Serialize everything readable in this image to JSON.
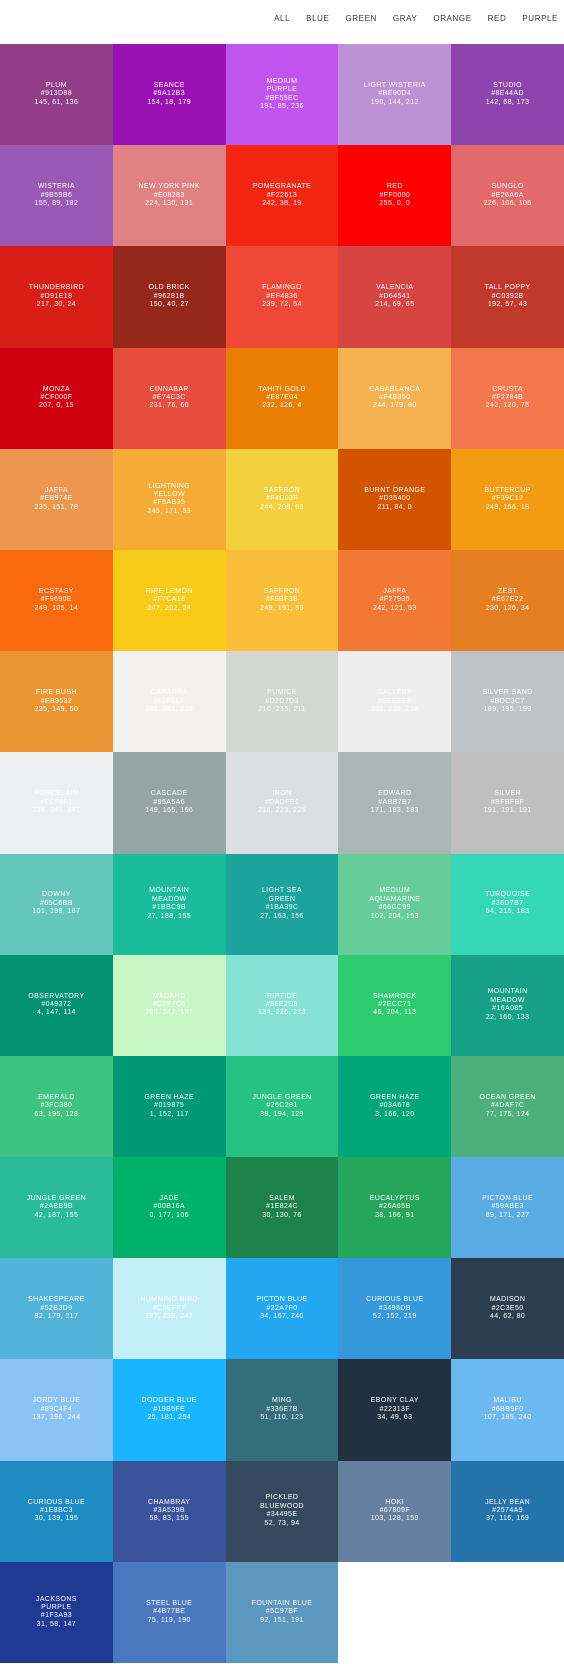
{
  "nav": [
    "ALL",
    "BLUE",
    "GREEN",
    "GRAY",
    "ORANGE",
    "RED",
    "PURPLE"
  ],
  "swatches": [
    {
      "name": "PLUM",
      "hex": "#913D88",
      "rgb": "145, 61, 136"
    },
    {
      "name": "SEANCE",
      "hex": "#9A12B3",
      "rgb": "154, 18, 179"
    },
    {
      "name": "MEDIUM PURPLE",
      "hex": "#BF55EC",
      "rgb": "191, 85, 236"
    },
    {
      "name": "LIGHT WISTERIA",
      "hex": "#BE90D4",
      "rgb": "190, 144, 212"
    },
    {
      "name": "STUDIO",
      "hex": "#8E44AD",
      "rgb": "142, 68, 173"
    },
    {
      "name": "WISTERIA",
      "hex": "#9B59B6",
      "rgb": "155, 89, 182"
    },
    {
      "name": "NEW YORK PINK",
      "hex": "#E08283",
      "rgb": "224, 130, 131"
    },
    {
      "name": "POMEGRANATE",
      "hex": "#F22613",
      "rgb": "242, 38, 19"
    },
    {
      "name": "RED",
      "hex": "#FF0000",
      "rgb": "255, 0, 0"
    },
    {
      "name": "SUNGLO",
      "hex": "#E26A6A",
      "rgb": "226, 106, 106"
    },
    {
      "name": "THUNDERBIRD",
      "hex": "#D91E18",
      "rgb": "217, 30, 24"
    },
    {
      "name": "OLD BRICK",
      "hex": "#96281B",
      "rgb": "150, 40, 27"
    },
    {
      "name": "FLAMINGO",
      "hex": "#EF4836",
      "rgb": "239, 72, 54"
    },
    {
      "name": "VALENCIA",
      "hex": "#D64541",
      "rgb": "214, 69, 65"
    },
    {
      "name": "TALL POPPY",
      "hex": "#C0392B",
      "rgb": "192, 57, 43"
    },
    {
      "name": "MONZA",
      "hex": "#CF000F",
      "rgb": "207, 0, 15"
    },
    {
      "name": "CINNABAR",
      "hex": "#E74C3C",
      "rgb": "231, 76, 60"
    },
    {
      "name": "TAHITI GOLD",
      "hex": "#E87E04",
      "rgb": "232, 126, 4"
    },
    {
      "name": "CASABLANCA",
      "hex": "#F4B350",
      "rgb": "244, 179, 80"
    },
    {
      "name": "CRUSTA",
      "hex": "#F2784B",
      "rgb": "242, 120, 75"
    },
    {
      "name": "JAFFA",
      "hex": "#EB974E",
      "rgb": "235, 151, 78"
    },
    {
      "name": "LIGHTNING YELLOW",
      "hex": "#F5AB35",
      "rgb": "245, 171, 53"
    },
    {
      "name": "SAFFRON",
      "hex": "#F4D03F",
      "rgb": "244, 208, 63"
    },
    {
      "name": "BURNT ORANGE",
      "hex": "#D35400",
      "rgb": "211, 84, 0"
    },
    {
      "name": "BUTTERCUP",
      "hex": "#F39C12",
      "rgb": "243, 156, 18"
    },
    {
      "name": "ECSTASY",
      "hex": "#F9690E",
      "rgb": "249, 105, 14"
    },
    {
      "name": "RIPE LEMON",
      "hex": "#F7CA18",
      "rgb": "247, 202, 24"
    },
    {
      "name": "SAFFRON",
      "hex": "#F9BF3B",
      "rgb": "249, 191, 59"
    },
    {
      "name": "JAFFA",
      "hex": "#F27935",
      "rgb": "242, 121, 53"
    },
    {
      "name": "ZEST",
      "hex": "#E67E22",
      "rgb": "230, 126, 34"
    },
    {
      "name": "FIRE BUSH",
      "hex": "#EB9532",
      "rgb": "235, 149, 50"
    },
    {
      "name": "CARARRA",
      "hex": "#F2F1EF",
      "rgb": "242, 241, 239"
    },
    {
      "name": "PUMICE",
      "hex": "#D2D7D3",
      "rgb": "210, 215, 211"
    },
    {
      "name": "GALLERY",
      "hex": "#EEEEEE",
      "rgb": "238, 238, 238"
    },
    {
      "name": "SILVER SAND",
      "hex": "#BDC3C7",
      "rgb": "189, 195, 199"
    },
    {
      "name": "PORCELAIN",
      "hex": "#ECF0F1",
      "rgb": "236, 240, 241"
    },
    {
      "name": "CASCADE",
      "hex": "#95A5A6",
      "rgb": "149, 165, 166"
    },
    {
      "name": "IRON",
      "hex": "#DADFE1",
      "rgb": "218, 223, 225"
    },
    {
      "name": "EDWARD",
      "hex": "#ABB7B7",
      "rgb": "171, 183, 183"
    },
    {
      "name": "SILVER",
      "hex": "#BFBFBF",
      "rgb": "191, 191, 191"
    },
    {
      "name": "DOWNY",
      "hex": "#65C6BB",
      "rgb": "101, 198, 187"
    },
    {
      "name": "MOUNTAIN MEADOW",
      "hex": "#1BBC9B",
      "rgb": "27, 188, 155"
    },
    {
      "name": "LIGHT SEA GREEN",
      "hex": "#1BA39C",
      "rgb": "27, 163, 156"
    },
    {
      "name": "MEDIUM AQUAMARINE",
      "hex": "#66CC99",
      "rgb": "102, 204, 153"
    },
    {
      "name": "TURQUOISE",
      "hex": "#36D7B7",
      "rgb": "54, 215, 183"
    },
    {
      "name": "OBSERVATORY",
      "hex": "#049372",
      "rgb": "4, 147, 114"
    },
    {
      "name": "MADANG",
      "hex": "#C8F7C5",
      "rgb": "200, 247, 197"
    },
    {
      "name": "RIPTIDE",
      "hex": "#86E2D5",
      "rgb": "134, 226, 213"
    },
    {
      "name": "SHAMROCK",
      "hex": "#2ECC71",
      "rgb": "46, 204, 113"
    },
    {
      "name": "MOUNTAIN MEADOW",
      "hex": "#16A085",
      "rgb": "22, 160, 133"
    },
    {
      "name": "EMERALD",
      "hex": "#3FC380",
      "rgb": "63, 195, 128"
    },
    {
      "name": "GREEN HAZE",
      "hex": "#019875",
      "rgb": "1, 152, 117"
    },
    {
      "name": "JUNGLE GREEN",
      "hex": "#26C281",
      "rgb": "38, 194, 129"
    },
    {
      "name": "GREEN HAZE",
      "hex": "#03A678",
      "rgb": "3, 166, 120"
    },
    {
      "name": "OCEAN GREEN",
      "hex": "#4DAF7C",
      "rgb": "77, 175, 124"
    },
    {
      "name": "JUNGLE GREEN",
      "hex": "#2ABB9B",
      "rgb": "42, 187, 155"
    },
    {
      "name": "JADE",
      "hex": "#00B16A",
      "rgb": "0, 177, 106"
    },
    {
      "name": "SALEM",
      "hex": "#1E824C",
      "rgb": "30, 130, 76"
    },
    {
      "name": "EUCALYPTUS",
      "hex": "#26A65B",
      "rgb": "38, 166, 91"
    },
    {
      "name": "PICTON BLUE",
      "hex": "#59ABE3",
      "rgb": "89, 171, 227"
    },
    {
      "name": "SHAKESPEARE",
      "hex": "#52B3D9",
      "rgb": "82, 179, 217"
    },
    {
      "name": "HUMMING BIRD",
      "hex": "#C5EFF7",
      "rgb": "197, 239, 247"
    },
    {
      "name": "PICTON BLUE",
      "hex": "#22A7F0",
      "rgb": "34, 167, 240"
    },
    {
      "name": "CURIOUS BLUE",
      "hex": "#3498DB",
      "rgb": "52, 152, 219"
    },
    {
      "name": "MADISON",
      "hex": "#2C3E50",
      "rgb": "44, 62, 80"
    },
    {
      "name": "JORDY BLUE",
      "hex": "#89C4F4",
      "rgb": "137, 196, 244"
    },
    {
      "name": "DODGER BLUE",
      "hex": "#19B5FE",
      "rgb": "25, 181, 254"
    },
    {
      "name": "MING",
      "hex": "#336E7B",
      "rgb": "51, 110, 123"
    },
    {
      "name": "EBONY CLAY",
      "hex": "#22313F",
      "rgb": "34, 49, 63"
    },
    {
      "name": "MALIBU",
      "hex": "#6BB9F0",
      "rgb": "107, 185, 240"
    },
    {
      "name": "CURIOUS BLUE",
      "hex": "#1E8BC3",
      "rgb": "30, 139, 195"
    },
    {
      "name": "CHAMBRAY",
      "hex": "#3A539B",
      "rgb": "58, 83, 155"
    },
    {
      "name": "PICKLED BLUEWOOD",
      "hex": "#34495E",
      "rgb": "52, 73, 94"
    },
    {
      "name": "HOKI",
      "hex": "#67809F",
      "rgb": "103, 128, 159"
    },
    {
      "name": "JELLY BEAN",
      "hex": "#2574A9",
      "rgb": "37, 116, 169"
    },
    {
      "name": "JACKSONS PURPLE",
      "hex": "#1F3A93",
      "rgb": "31, 58, 147"
    },
    {
      "name": "STEEL BLUE",
      "hex": "#4B77BE",
      "rgb": "75, 119, 190"
    },
    {
      "name": "FOUNTAIN BLUE",
      "hex": "#5C97BF",
      "rgb": "92, 151, 191"
    }
  ]
}
